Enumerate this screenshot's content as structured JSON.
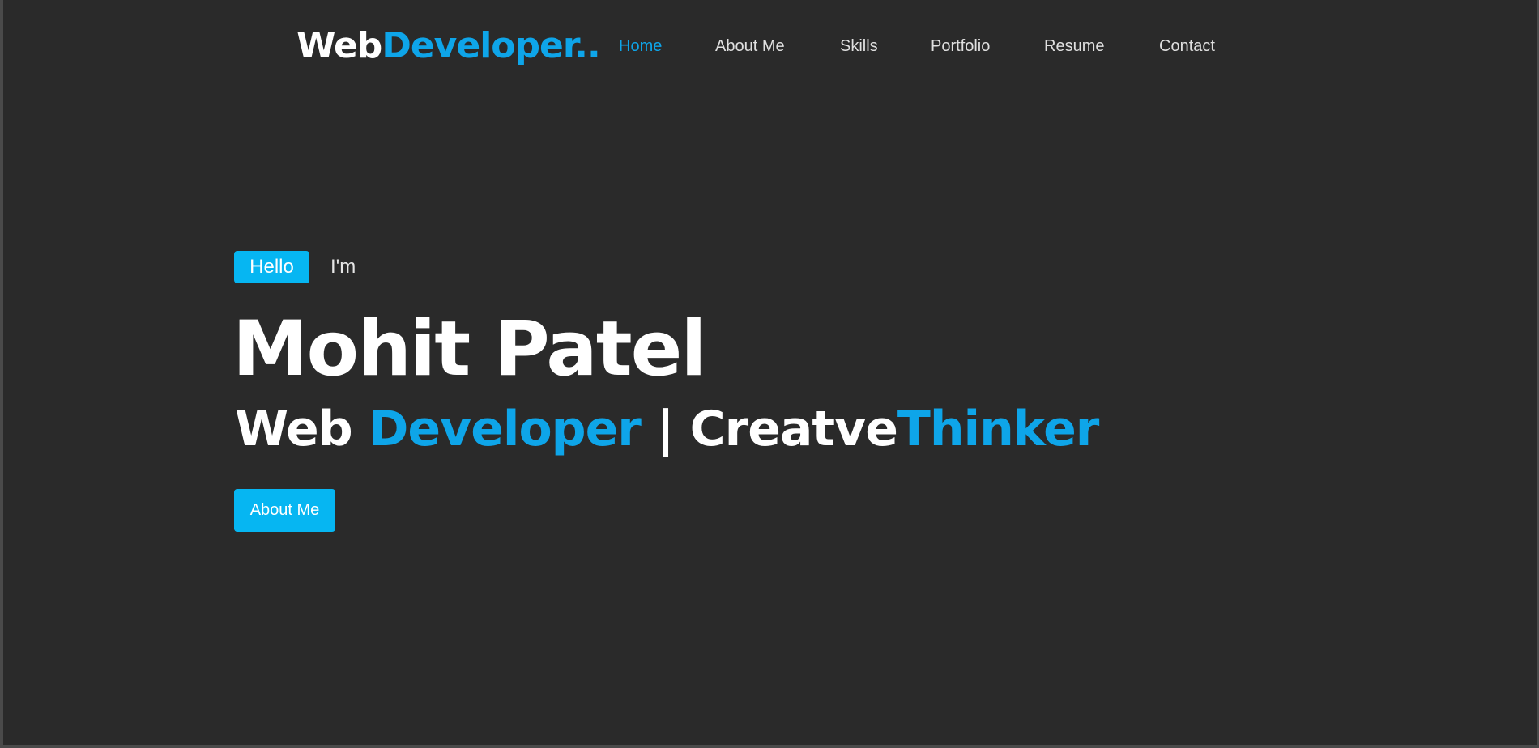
{
  "brand": {
    "part1": "Web",
    "part2": "Developer.."
  },
  "nav": {
    "items": [
      {
        "label": "Home",
        "active": true
      },
      {
        "label": "About Me",
        "active": false
      },
      {
        "label": "Skills",
        "active": false
      },
      {
        "label": "Portfolio",
        "active": false
      },
      {
        "label": "Resume",
        "active": false
      },
      {
        "label": "Contact",
        "active": false
      }
    ]
  },
  "hero": {
    "badge": "Hello",
    "intro": "I'm",
    "name": "Mohit Patel",
    "tagline": {
      "p1": "Web ",
      "p2": "Developer",
      "p3": " | Creatve",
      "p4": "Thinker"
    },
    "cta": "About Me"
  },
  "colors": {
    "background": "#2a2a2a",
    "accent": "#0ea5e9",
    "button": "#06b6f2",
    "text": "#ffffff"
  }
}
